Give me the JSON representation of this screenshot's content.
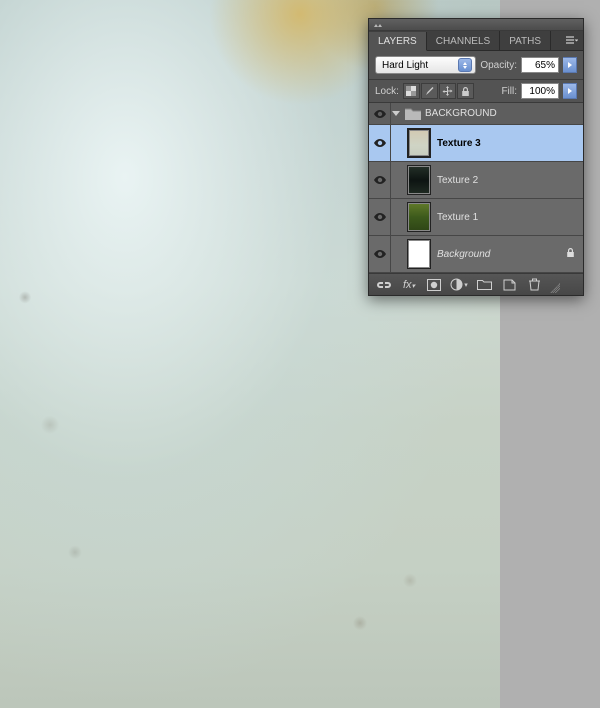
{
  "tabs": {
    "layers": "LAYERS",
    "channels": "CHANNELS",
    "paths": "PATHS"
  },
  "blend": {
    "mode": "Hard Light",
    "opacity_label": "Opacity:",
    "opacity_value": "65%"
  },
  "lock": {
    "label": "Lock:",
    "fill_label": "Fill:",
    "fill_value": "100%"
  },
  "group": {
    "name": "BACKGROUND"
  },
  "layers": {
    "texture3": "Texture 3",
    "texture2": "Texture 2",
    "texture1": "Texture 1",
    "background": "Background"
  }
}
